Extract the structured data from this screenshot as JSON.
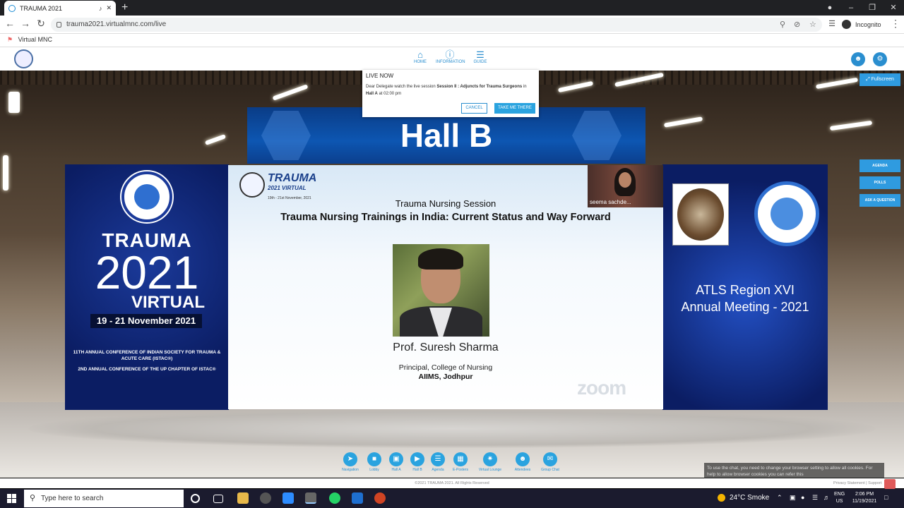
{
  "browser": {
    "tab_title": "TRAUMA 2021",
    "url": "trauma2021.virtualmnc.com/live",
    "incognito_label": "Incognito",
    "bookmark": "Virtual MNC"
  },
  "site_nav": [
    {
      "label": "HOME",
      "icon": "home-icon"
    },
    {
      "label": "INFORMATION",
      "icon": "info-icon"
    },
    {
      "label": "GUIDE",
      "icon": "signpost-icon"
    }
  ],
  "popup": {
    "heading": "LIVE NOW",
    "message_prefix": "Dear Delegate watch the live session ",
    "session": "Session II : Adjuncts for Trauma Surgeons",
    "message_mid": " in ",
    "hall": "Hall A",
    "message_at": " at ",
    "time": "02:00 pm",
    "cancel": "CANCEL",
    "take_me": "TAKE ME THERE"
  },
  "hall_sign": "Hall B",
  "side_buttons": {
    "fullscreen": "Fullscreen",
    "agenda": "AGENDA",
    "polls": "POLLS",
    "ask": "ASK A QUESTION"
  },
  "left_banner": {
    "title1": "TRAUMA",
    "title2": "2021",
    "title3": "VIRTUAL",
    "dates": "19 - 21 November 2021",
    "conf1": "11TH ANNUAL CONFERENCE OF INDIAN SOCIETY FOR TRAUMA & ACUTE CARE (ISTAC®)",
    "conf2": "2ND ANNUAL CONFERENCE OF THE UP CHAPTER OF ISTAC®"
  },
  "right_banner": {
    "line1": "ATLS Region XVI",
    "line2": "Annual Meeting - 2021"
  },
  "slide": {
    "logo_title": "TRAUMA",
    "logo_sub": "2021 VIRTUAL",
    "logo_dates": "19th - 21st November, 2021",
    "session": "Trauma Nursing Session",
    "title": "Trauma Nursing Trainings in India: Current Status and Way Forward",
    "speaker": "Prof. Suresh Sharma",
    "role": "Principal, College of Nursing",
    "institute": "AIIMS, Jodhpur",
    "watermark": "zoom",
    "participant": "seema sachde..."
  },
  "dock": [
    {
      "label": "Navigation"
    },
    {
      "label": "Lobby"
    },
    {
      "label": "Hall A"
    },
    {
      "label": "Hall B"
    },
    {
      "label": "Agenda"
    },
    {
      "label": "E-Posters"
    },
    {
      "label": "Virtual Lounge"
    },
    {
      "label": "Attendees"
    },
    {
      "label": "Group Chat"
    }
  ],
  "cookie_notice": "To use the chat, you need to change your browser setting to allow all cookies. For help to allow browser cookies you can refer this",
  "footer": {
    "copyright": "©2021 TRAUMA 2021. All Rights Reserved",
    "links": "Privacy Statement | Support"
  },
  "taskbar": {
    "search_placeholder": "Type here to search",
    "weather": "24°C  Smoke",
    "lang1": "ENG",
    "lang2": "US",
    "time": "2:06 PM",
    "date": "11/19/2021"
  }
}
